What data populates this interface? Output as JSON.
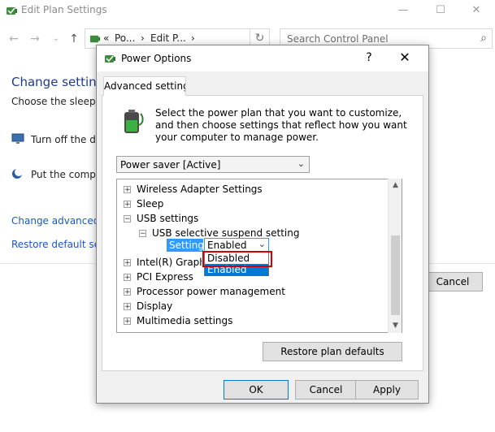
{
  "back_window": {
    "title": "Edit Plan Settings",
    "minimize_glyph": "—",
    "maximize_glyph": "☐",
    "close_glyph": "✕",
    "address_chevron": "«",
    "address_segments": [
      "Po...",
      "Edit P..."
    ],
    "address_sep": "›",
    "search_placeholder": "Search Control Panel",
    "heading": "Change setting",
    "description": "Choose the sleep an",
    "row_display": "Turn off the dis",
    "row_sleep": "Put the comput",
    "link_advanced": "Change advanced p",
    "link_restore": "Restore default setti",
    "cancel_label": "Cancel"
  },
  "dialog": {
    "title": "Power Options",
    "help_glyph": "?",
    "close_glyph": "✕",
    "tab_label": "Advanced settings",
    "intro_text": "Select the power plan that you want to customize, and then choose settings that reflect how you want your computer to manage power.",
    "plan_selected": "Power saver [Active]",
    "tree": [
      {
        "label": "Wireless Adapter Settings",
        "expander": "+"
      },
      {
        "label": "Sleep",
        "expander": "+"
      },
      {
        "label": "USB settings",
        "expander": "−"
      },
      {
        "label": "USB selective suspend setting",
        "expander": "−"
      },
      {
        "label": "Intel(R) Graphics Settings",
        "expander": "+"
      },
      {
        "label": "PCI Express",
        "expander": "+"
      },
      {
        "label": "Processor power management",
        "expander": "+"
      },
      {
        "label": "Display",
        "expander": "+"
      },
      {
        "label": "Multimedia settings",
        "expander": "+"
      }
    ],
    "setting_label": "Setting:",
    "setting_value": "Enabled",
    "dropdown_options": [
      "Disabled",
      "Enabled"
    ],
    "restore_button": "Restore plan defaults",
    "ok_button": "OK",
    "cancel_button": "Cancel",
    "apply_button": "Apply"
  },
  "colors": {
    "accent": "#0078d7",
    "highlight_box": "#d40000",
    "link": "#1a56c9"
  }
}
